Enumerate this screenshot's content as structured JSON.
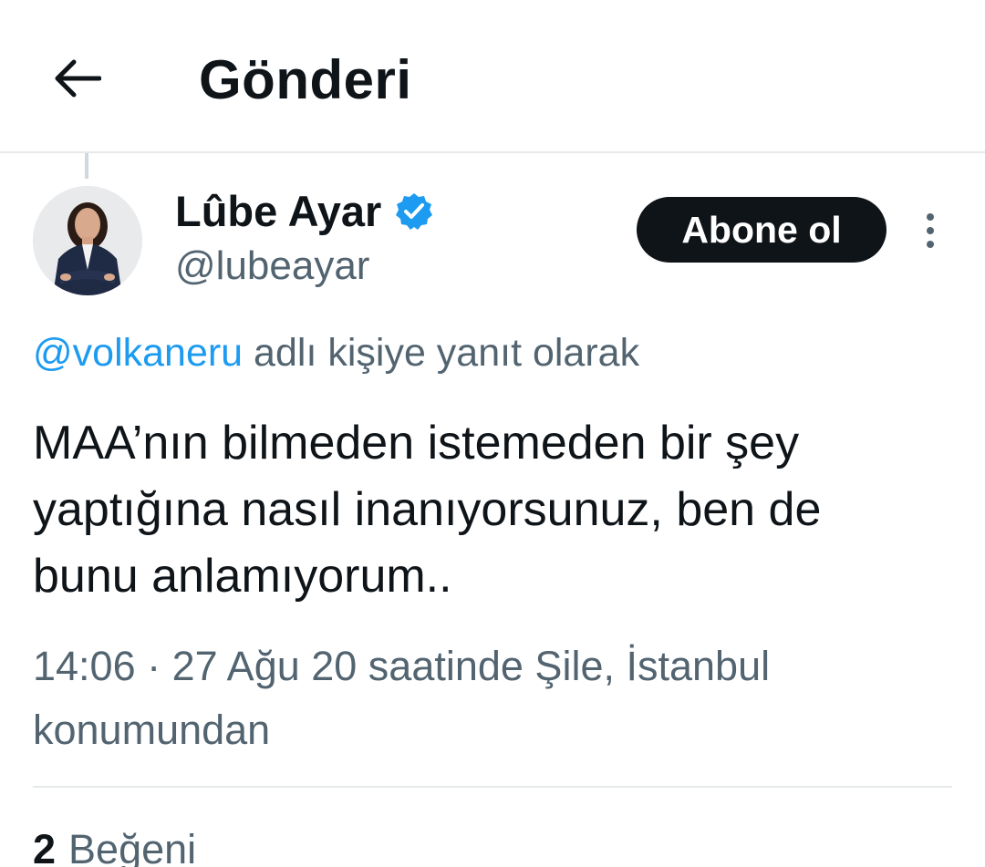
{
  "header": {
    "back_icon": "arrow-left-icon",
    "title": "Gönderi"
  },
  "tweet": {
    "author": {
      "display_name": "Lûbe Ayar",
      "handle": "@lubeayar",
      "verified": true,
      "verified_color": "#1d9bf0"
    },
    "follow_label": "Abone ol",
    "more_icon": "more-vertical-icon",
    "reply_context": {
      "mention": "@volkaneru",
      "text": " adlı kişiye yanıt olarak"
    },
    "text": "MAA’nın bilmeden istemeden bir şey\nyaptığına nasıl inanıyorsunuz, ben de\nbunu anlamıyorum..",
    "meta": "14:06 · 27 Ağu 20 saatinde Şile, İstanbul konumundan",
    "likes": {
      "count": "2",
      "label": "Beğeni"
    }
  },
  "colors": {
    "accent": "#1d9bf0",
    "text_primary": "#0f1419",
    "text_secondary": "#536471",
    "button_bg": "#0f1419"
  }
}
